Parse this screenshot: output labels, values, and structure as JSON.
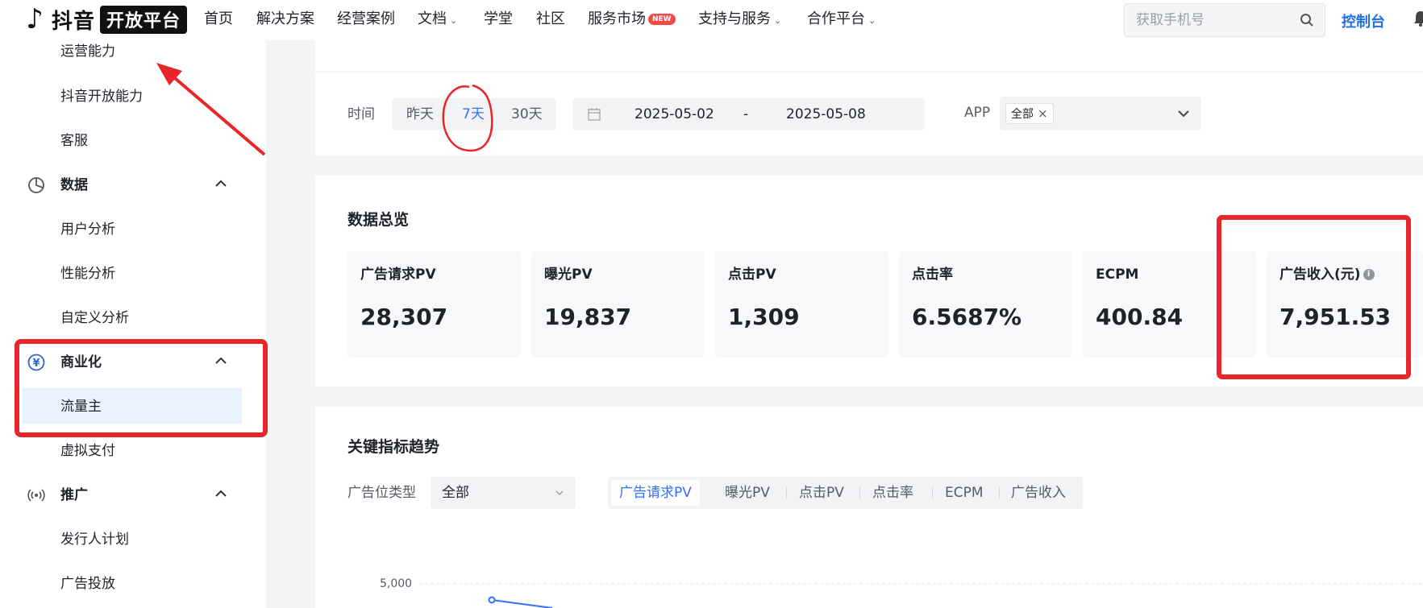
{
  "brand": {
    "name": "抖音",
    "badge": "开放平台"
  },
  "nav": {
    "items": [
      {
        "label": "首页",
        "dropdown": false
      },
      {
        "label": "解决方案",
        "dropdown": false
      },
      {
        "label": "经营案例",
        "dropdown": false
      },
      {
        "label": "文档",
        "dropdown": true
      },
      {
        "label": "学堂",
        "dropdown": false
      },
      {
        "label": "社区",
        "dropdown": false
      },
      {
        "label": "服务市场",
        "dropdown": false,
        "badge": "NEW"
      },
      {
        "label": "支持与服务",
        "dropdown": true
      },
      {
        "label": "合作平台",
        "dropdown": true
      }
    ],
    "search_placeholder": "获取手机号",
    "console": "控制台"
  },
  "sidebar": {
    "items": [
      {
        "type": "sub",
        "label": "运营能力"
      },
      {
        "type": "sub",
        "label": "抖音开放能力"
      },
      {
        "type": "sub",
        "label": "客服"
      },
      {
        "type": "group",
        "label": "数据",
        "icon": "pie-chart-icon",
        "expanded": true
      },
      {
        "type": "sub",
        "label": "用户分析"
      },
      {
        "type": "sub",
        "label": "性能分析"
      },
      {
        "type": "sub",
        "label": "自定义分析"
      },
      {
        "type": "group",
        "label": "商业化",
        "icon": "yuan-circle-icon",
        "expanded": true
      },
      {
        "type": "sub",
        "label": "流量主",
        "active": true
      },
      {
        "type": "sub",
        "label": "虚拟支付"
      },
      {
        "type": "group",
        "label": "推广",
        "icon": "broadcast-icon",
        "expanded": true
      },
      {
        "type": "sub",
        "label": "发行人计划"
      },
      {
        "type": "sub",
        "label": "广告投放"
      }
    ]
  },
  "filters": {
    "time_label": "时间",
    "time_options": [
      "昨天",
      "7天",
      "30天"
    ],
    "time_selected": "7天",
    "date_start": "2025-05-02",
    "date_sep": "-",
    "date_end": "2025-05-08",
    "app_label": "APP",
    "app_tag": "全部"
  },
  "overview": {
    "title": "数据总览",
    "metrics": [
      {
        "label": "广告请求PV",
        "value": "28,307"
      },
      {
        "label": "曝光PV",
        "value": "19,837"
      },
      {
        "label": "点击PV",
        "value": "1,309"
      },
      {
        "label": "点击率",
        "value": "6.5687%"
      },
      {
        "label": "ECPM",
        "value": "400.84"
      },
      {
        "label": "广告收入(元)",
        "value": "7,951.53",
        "info": true
      }
    ]
  },
  "trend": {
    "title": "关键指标趋势",
    "ad_type_label": "广告位类型",
    "ad_type_value": "全部",
    "tabs": [
      "广告请求PV",
      "曝光PV",
      "点击PV",
      "点击率",
      "ECPM",
      "广告收入"
    ],
    "active_tab": "广告请求PV",
    "y_tick": "5,000"
  },
  "colors": {
    "accent": "#3370ff",
    "annotation": "#e8262a",
    "active_bg": "#e8f3ff"
  }
}
